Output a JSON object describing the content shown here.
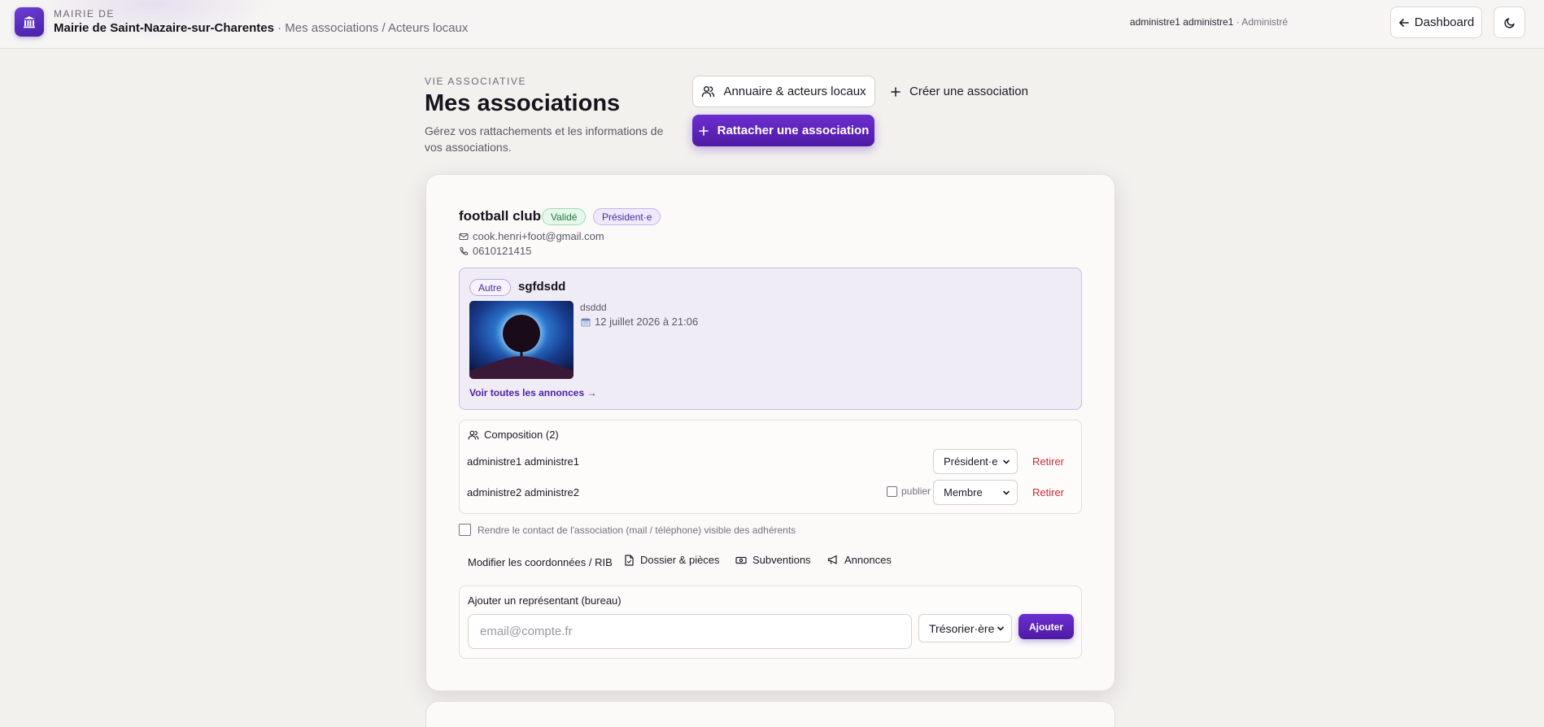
{
  "header": {
    "kicker": "MAIRIE DE",
    "mairie_name": "Mairie de Saint-Nazaire-sur-Charentes",
    "breadcrumb": "· Mes associations / Acteurs locaux",
    "user_name": "administre1 administre1",
    "user_role": "· Administré",
    "dashboard_label": "Dashboard",
    "icons": {
      "logo": "building-icon",
      "back": "arrow-left-icon",
      "theme": "moon-icon"
    }
  },
  "page": {
    "kicker": "VIE ASSOCIATIVE",
    "title": "Mes associations",
    "description": "Gérez vos rattachements et les informations de vos associations.",
    "buttons": {
      "annuaire": "Annuaire & acteurs locaux",
      "creer": "Créer une association",
      "rattacher": "Rattacher une association"
    }
  },
  "association": {
    "name": "football club",
    "status_badge": "Validé",
    "role_badge": "Président·e",
    "email": "cook.henri+foot@gmail.com",
    "phone": "0610121415",
    "annonce": {
      "category": "Autre",
      "title": "sgfdsdd",
      "description": "dsddd",
      "date": "12 juillet 2026 à 21:06",
      "link": "Voir toutes les annonces →"
    },
    "composition": {
      "title": "Composition (2)",
      "members": [
        {
          "name": "administre1 administre1",
          "role": "Président·e",
          "action": "Retirer"
        },
        {
          "name": "administre2 administre2",
          "publish_label": "publier",
          "role": "Membre",
          "action": "Retirer"
        }
      ]
    },
    "visibility_label": "Rendre le contact de l'association (mail / téléphone) visible des adhérents",
    "actions": {
      "modifier": "Modifier les coordonnées / RIB",
      "dossier": "Dossier & pièces",
      "subventions": "Subventions",
      "annonces": "Annonces"
    },
    "representant": {
      "label": "Ajouter un représentant (bureau)",
      "placeholder": "email@compte.fr",
      "role": "Trésorier·ère",
      "button": "Ajouter"
    }
  },
  "colors": {
    "accent": "#5b22b8",
    "danger": "#d4283a",
    "success": "#1f7a3c",
    "background": "#f3f1ee"
  }
}
